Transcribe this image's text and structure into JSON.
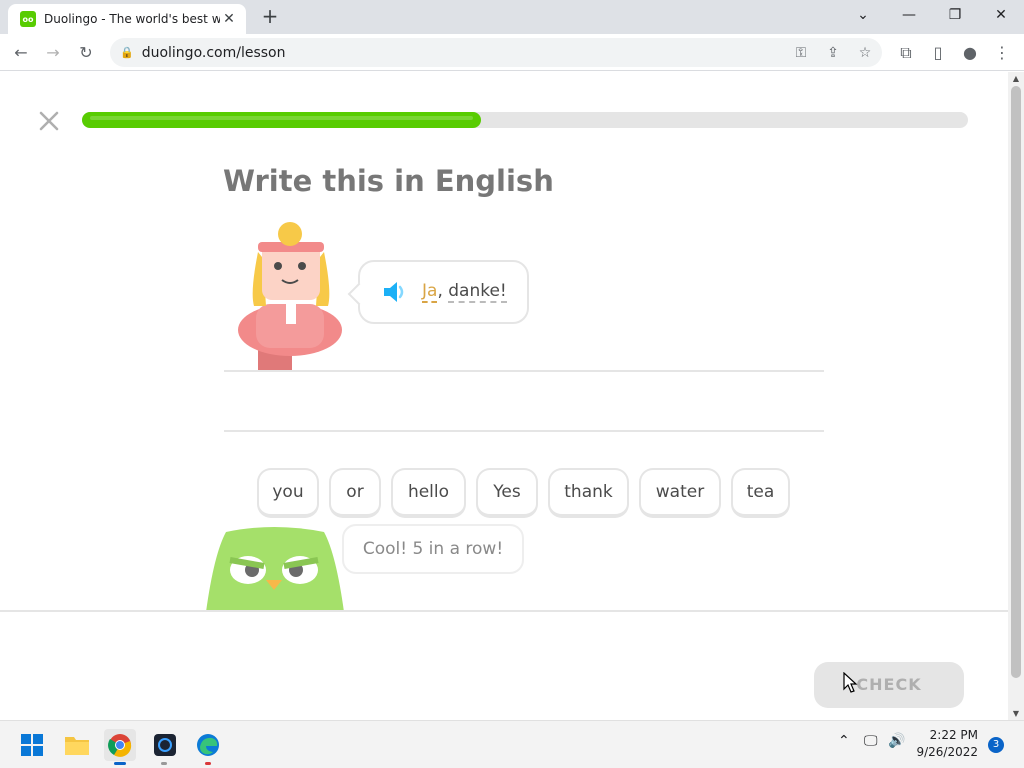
{
  "browser": {
    "tab_title": "Duolingo - The world's best way",
    "favicon_text": "oo",
    "url": "duolingo.com/lesson"
  },
  "lesson": {
    "progress_fraction": 0.45,
    "prompt": "Write this in English",
    "phrase_word1": "Ja",
    "phrase_sep": ", ",
    "phrase_word2": "danke!",
    "word_bank": [
      "you",
      "or",
      "hello",
      "Yes",
      "thank",
      "water",
      "tea"
    ],
    "streak_message": "Cool! 5 in a row!",
    "check_label": "CHECK"
  },
  "taskbar": {
    "time": "2:22 PM",
    "date": "9/26/2022",
    "notification_count": "3"
  },
  "colors": {
    "duolingo_green": "#58cc02",
    "header_gray": "#777777",
    "check_disabled": "#e5e5e5"
  }
}
